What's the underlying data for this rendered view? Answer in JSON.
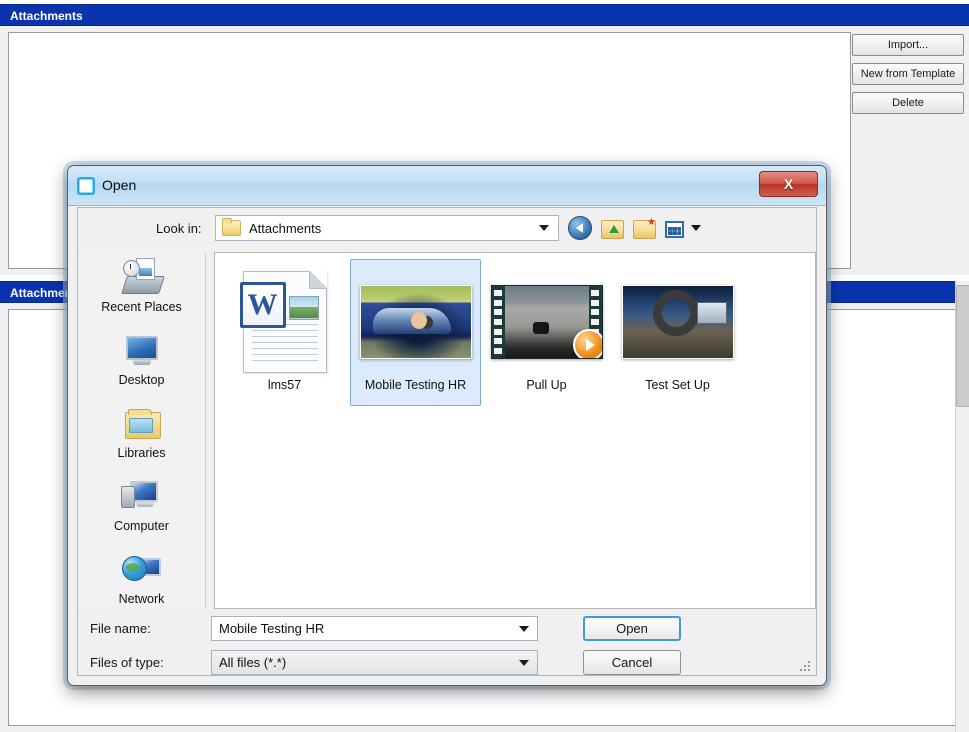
{
  "background": {
    "panels": [
      {
        "title": "Attachments"
      },
      {
        "title": "Attachments"
      }
    ],
    "buttons": [
      {
        "label": "Import..."
      },
      {
        "label": "New from Template"
      },
      {
        "label": "Delete"
      }
    ]
  },
  "dialog": {
    "title": "Open",
    "title_icon": "app-x-icon",
    "close_label": "X",
    "lookin": {
      "label": "Look in:",
      "value": "Attachments",
      "icon": "folder-icon"
    },
    "toolbar": [
      {
        "name": "back-icon",
        "tooltip": "Back"
      },
      {
        "name": "up-one-level-icon",
        "tooltip": "Up One Level"
      },
      {
        "name": "create-new-folder-icon",
        "tooltip": "Create New Folder"
      },
      {
        "name": "views-icon",
        "tooltip": "Views"
      }
    ],
    "places": [
      {
        "label": "Recent Places",
        "icon": "recent-places-icon"
      },
      {
        "label": "Desktop",
        "icon": "desktop-icon"
      },
      {
        "label": "Libraries",
        "icon": "libraries-icon"
      },
      {
        "label": "Computer",
        "icon": "computer-icon"
      },
      {
        "label": "Network",
        "icon": "network-icon"
      }
    ],
    "files": [
      {
        "label": "lms57",
        "kind": "word-document",
        "selected": false
      },
      {
        "label": "Mobile Testing HR",
        "kind": "image",
        "selected": true
      },
      {
        "label": "Pull Up",
        "kind": "video",
        "selected": false
      },
      {
        "label": "Test Set Up",
        "kind": "image",
        "selected": false
      }
    ],
    "filename": {
      "label": "File name:",
      "value": "Mobile Testing HR"
    },
    "filetype": {
      "label": "Files of type:",
      "value": "All files (*.*)"
    },
    "open_label": "Open",
    "cancel_label": "Cancel"
  },
  "colors": {
    "panel_header": "#0a34ae",
    "selection": "#dbeafc",
    "selection_border": "#7aadd8",
    "focus_border": "#3f9ad6",
    "close_button": "#bb3226"
  }
}
